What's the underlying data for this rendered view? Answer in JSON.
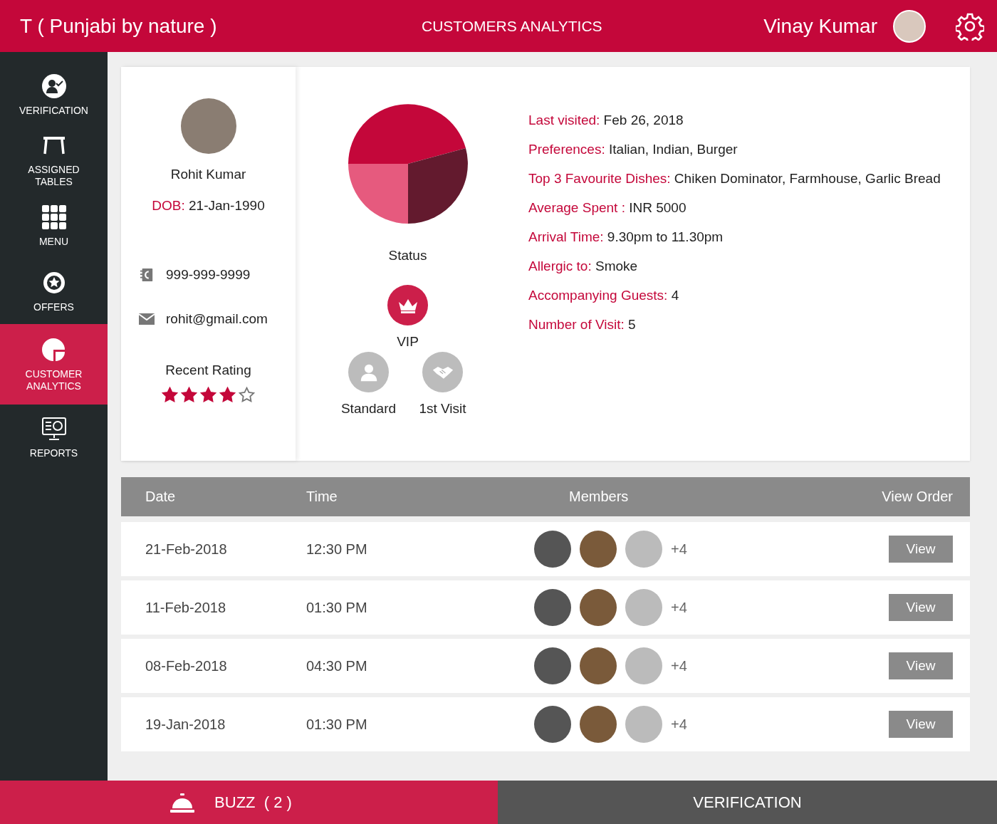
{
  "header": {
    "restaurant": "T ( Punjabi by nature )",
    "title": "CUSTOMERS ANALYTICS",
    "user": "Vinay Kumar"
  },
  "sidebar": {
    "items": [
      {
        "label": "VERIFICATION",
        "kind": "verify",
        "selected": false
      },
      {
        "label": "ASSIGNED TABLES",
        "kind": "table",
        "selected": false
      },
      {
        "label": "MENU",
        "kind": "grid",
        "selected": false
      },
      {
        "label": "OFFERS",
        "kind": "offer",
        "selected": false
      },
      {
        "label": "CUSTOMER ANALYTICS",
        "kind": "pie",
        "selected": true
      },
      {
        "label": "REPORTS",
        "kind": "report",
        "selected": false
      }
    ]
  },
  "profile": {
    "name": "Rohit Kumar",
    "dob_label": "DOB:",
    "dob": "21-Jan-1990",
    "phone": "999-999-9999",
    "email": "rohit@gmail.com",
    "rating_label": "Recent Rating",
    "stars": 4
  },
  "status": {
    "label": "Status",
    "options": [
      {
        "label": "VIP",
        "kind": "crown",
        "selected": true
      },
      {
        "label": "Standard",
        "kind": "person",
        "selected": false
      },
      {
        "label": "1st Visit",
        "kind": "handshake",
        "selected": false
      }
    ]
  },
  "details": [
    {
      "label": "Last visited:",
      "value": "Feb 26, 2018"
    },
    {
      "label": "Preferences:",
      "value": "Italian, Indian, Burger"
    },
    {
      "label": "Top 3 Favourite Dishes:",
      "value": "Chiken Dominator, Farmhouse, Garlic Bread"
    },
    {
      "label": "Average Spent :",
      "value": "INR 5000"
    },
    {
      "label": "Arrival Time:",
      "value": "9.30pm to 11.30pm"
    },
    {
      "label": "Allergic to:",
      "value": "Smoke"
    },
    {
      "label": "Accompanying Guests:",
      "value": "4"
    },
    {
      "label": "Number of Visit:",
      "value": "5"
    }
  ],
  "table": {
    "columns": [
      "Date",
      "Time",
      "Members",
      "View Order"
    ],
    "rows": [
      {
        "date": "21-Feb-2018",
        "time": "12:30 PM",
        "extra_members": "+4",
        "action": "View"
      },
      {
        "date": "11-Feb-2018",
        "time": "01:30 PM",
        "extra_members": "+4",
        "action": "View"
      },
      {
        "date": "08-Feb-2018",
        "time": "04:30 PM",
        "extra_members": "+4",
        "action": "View"
      },
      {
        "date": "19-Jan-2018",
        "time": "01:30 PM",
        "extra_members": "+4",
        "action": "View"
      }
    ]
  },
  "footer": {
    "buzz": "BUZZ  ( 2 )",
    "verification": "VERIFICATION"
  }
}
